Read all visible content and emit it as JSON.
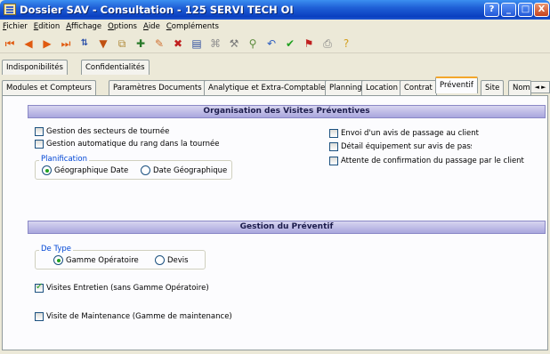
{
  "window": {
    "title": "Dossier SAV - Consultation - 125 SERVI TECH OI",
    "buttons": {
      "help": "?",
      "minimize": "_",
      "maximize": "□",
      "close": "X"
    }
  },
  "menu": [
    {
      "underlined": "F",
      "rest": "ichier"
    },
    {
      "underlined": "E",
      "rest": "dition"
    },
    {
      "underlined": "A",
      "rest": "ffichage"
    },
    {
      "underlined": "O",
      "rest": "ptions"
    },
    {
      "underlined": "A",
      "rest": "ide"
    },
    {
      "underlined": "C",
      "rest": "ompléments"
    }
  ],
  "toolbar": {
    "icons": [
      "first-record-icon",
      "previous-record-icon",
      "next-record-icon",
      "last-record-icon",
      "sort-icon",
      "filter-icon",
      "copy-icon",
      "add-icon",
      "edit-icon",
      "delete-icon",
      "note-icon",
      "attachment-icon",
      "tools-icon",
      "search-icon",
      "undo-icon",
      "validate-icon",
      "flag-icon",
      "print-icon",
      "help-icon"
    ]
  },
  "tabs_row1": [
    "Indisponibilités",
    "Confidentialités"
  ],
  "tabs_row2": {
    "items": [
      "Modules et Compteurs",
      "Paramètres Documents",
      "Analytique et Extra-Comptable",
      "Planning",
      "Location",
      "Contrat",
      "Préventif",
      "Site",
      "Nom"
    ],
    "active": "Préventif",
    "scroll": "◄ ►"
  },
  "sections": {
    "organisation": {
      "title": "Organisation des Visites Préventives",
      "checkboxes_left": [
        {
          "label": "Gestion des secteurs de tournée",
          "checked": false
        },
        {
          "label": "Gestion automatique du rang dans la tournée",
          "checked": false
        }
      ],
      "planification": {
        "legend": "Planification",
        "options": [
          {
            "label": "Géographique Date",
            "checked": true
          },
          {
            "label": "Date Géographique",
            "checked": false
          }
        ]
      },
      "checkboxes_right": [
        {
          "label": "Envoi d'un avis de passage au client",
          "checked": false
        },
        {
          "label": "Détail équipement sur avis de passa",
          "checked": false
        },
        {
          "label": "Attente de confirmation du passage par le client",
          "checked": false
        }
      ]
    },
    "gestion": {
      "title": "Gestion du Préventif",
      "de_type": {
        "legend": "De Type",
        "options": [
          {
            "label": "Gamme Opératoire",
            "checked": true
          },
          {
            "label": "Devis",
            "checked": false
          }
        ]
      },
      "checkboxes": [
        {
          "label": "Visites Entretien (sans Gamme Opératoire)",
          "checked": true
        },
        {
          "label": "Visite de Maintenance (Gamme de maintenance)",
          "checked": false
        }
      ]
    }
  },
  "colors": {
    "title_bar": "#0a3fc0",
    "active_tab_accent": "#f3a72b",
    "section_header": "#a9a6dd",
    "legend_text": "#0046d5",
    "check_mark": "#21a121"
  }
}
